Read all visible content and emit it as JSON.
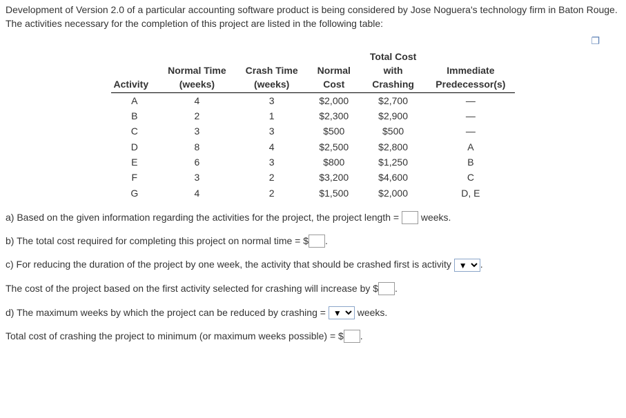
{
  "intro": "Development of Version 2.0 of a particular accounting software product is being considered by Jose Noguera's technology firm in Baton Rouge. The activities necessary for the completion of this project are listed in the following table:",
  "headers": {
    "activity": "Activity",
    "normal_time": "Normal Time (weeks)",
    "crash_time": "Crash Time (weeks)",
    "normal_cost": "Normal Cost",
    "total_cost": "Total Cost with Crashing",
    "predecessor": "Immediate Predecessor(s)"
  },
  "rows": [
    {
      "act": "A",
      "nt": "4",
      "ct": "3",
      "nc": "$2,000",
      "tc": "$2,700",
      "pred": "—"
    },
    {
      "act": "B",
      "nt": "2",
      "ct": "1",
      "nc": "$2,300",
      "tc": "$2,900",
      "pred": "—"
    },
    {
      "act": "C",
      "nt": "3",
      "ct": "3",
      "nc": "$500",
      "tc": "$500",
      "pred": "—"
    },
    {
      "act": "D",
      "nt": "8",
      "ct": "4",
      "nc": "$2,500",
      "tc": "$2,800",
      "pred": "A"
    },
    {
      "act": "E",
      "nt": "6",
      "ct": "3",
      "nc": "$800",
      "tc": "$1,250",
      "pred": "B"
    },
    {
      "act": "F",
      "nt": "3",
      "ct": "2",
      "nc": "$3,200",
      "tc": "$4,600",
      "pred": "C"
    },
    {
      "act": "G",
      "nt": "4",
      "ct": "2",
      "nc": "$1,500",
      "tc": "$2,000",
      "pred": "D, E"
    }
  ],
  "q": {
    "a_pre": "a) Based on the given information regarding the activities for the project, the project length =",
    "a_post": "weeks.",
    "b_pre": "b) The total cost required for completing this project on normal time = $",
    "b_post": ".",
    "c_pre": "c) For reducing the duration of the project by one week, the activity that should be crashed first is activity",
    "c_post": ".",
    "c2_pre": "The cost of the project based on the first activity selected for crashing will increase by $",
    "c2_post": ".",
    "d_pre": "d) The maximum weeks by which the project can be reduced by crashing =",
    "d_post": "weeks.",
    "e_pre": "Total cost of crashing the project to minimum (or maximum weeks possible) = $",
    "e_post": "."
  },
  "select_placeholder": "▼"
}
